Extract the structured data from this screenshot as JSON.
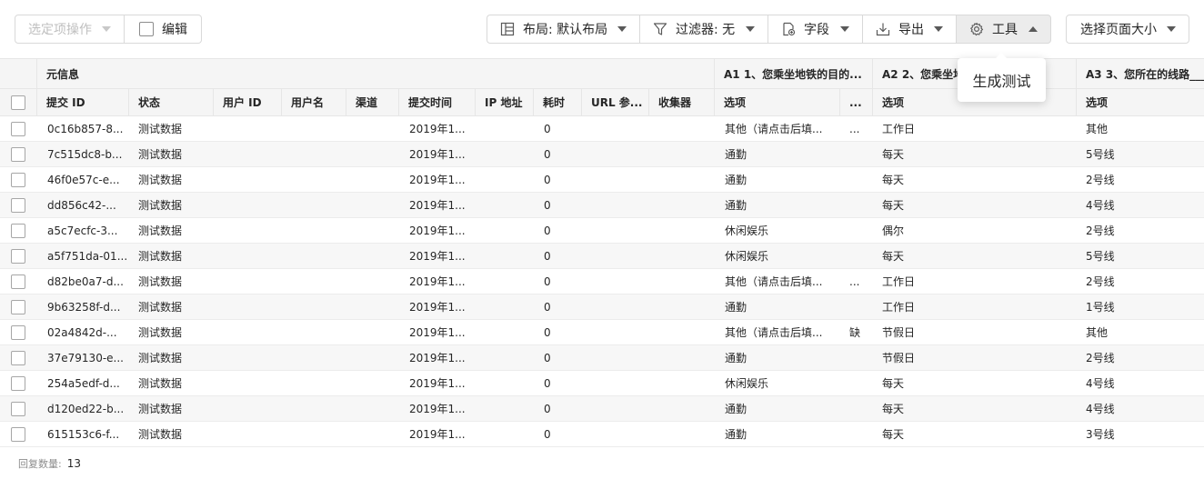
{
  "toolbar": {
    "selection_actions": "选定项操作",
    "edit": "编辑",
    "layout": "布局: 默认布局",
    "filter": "过滤器: 无",
    "fields": "字段",
    "export": "导出",
    "tools": "工具",
    "page_size": "选择页面大小"
  },
  "tooltip": {
    "text": "生成测试"
  },
  "table": {
    "groups": {
      "meta": "元信息",
      "a1": "A1 1、您乘坐地铁的目的...",
      "a2": "A2 2、您乘坐地",
      "a3": "A3 3、您所在的线路___"
    },
    "columns": [
      "提交 ID",
      "状态",
      "用户 ID",
      "用户名",
      "渠道",
      "提交时间",
      "IP 地址",
      "耗时",
      "URL 参...",
      "收集器",
      "选项",
      "...",
      "选项",
      "选项"
    ],
    "rows": [
      {
        "id": "0c16b857-8...",
        "status": "测试数据",
        "time": "2019年1...",
        "duration": "0",
        "a1": "其他（请点击后填...",
        "a1b": "...",
        "a2": "工作日",
        "a3": "其他"
      },
      {
        "id": "7c515dc8-b...",
        "status": "测试数据",
        "time": "2019年1...",
        "duration": "0",
        "a1": "通勤",
        "a1b": "",
        "a2": "每天",
        "a3": "5号线"
      },
      {
        "id": "46f0e57c-e...",
        "status": "测试数据",
        "time": "2019年1...",
        "duration": "0",
        "a1": "通勤",
        "a1b": "",
        "a2": "每天",
        "a3": "2号线"
      },
      {
        "id": "dd856c42-...",
        "status": "测试数据",
        "time": "2019年1...",
        "duration": "0",
        "a1": "通勤",
        "a1b": "",
        "a2": "每天",
        "a3": "4号线"
      },
      {
        "id": "a5c7ecfc-3...",
        "status": "测试数据",
        "time": "2019年1...",
        "duration": "0",
        "a1": "休闲娱乐",
        "a1b": "",
        "a2": "偶尔",
        "a3": "2号线"
      },
      {
        "id": "a5f751da-01...",
        "status": "测试数据",
        "time": "2019年1...",
        "duration": "0",
        "a1": "休闲娱乐",
        "a1b": "",
        "a2": "每天",
        "a3": "5号线"
      },
      {
        "id": "d82be0a7-d...",
        "status": "测试数据",
        "time": "2019年1...",
        "duration": "0",
        "a1": "其他（请点击后填...",
        "a1b": "...",
        "a2": "工作日",
        "a3": "2号线"
      },
      {
        "id": "9b63258f-d...",
        "status": "测试数据",
        "time": "2019年1...",
        "duration": "0",
        "a1": "通勤",
        "a1b": "",
        "a2": "工作日",
        "a3": "1号线"
      },
      {
        "id": "02a4842d-...",
        "status": "测试数据",
        "time": "2019年1...",
        "duration": "0",
        "a1": "其他（请点击后填...",
        "a1b": "缺",
        "a2": "节假日",
        "a3": "其他"
      },
      {
        "id": "37e79130-e...",
        "status": "测试数据",
        "time": "2019年1...",
        "duration": "0",
        "a1": "通勤",
        "a1b": "",
        "a2": "节假日",
        "a3": "2号线"
      },
      {
        "id": "254a5edf-d...",
        "status": "测试数据",
        "time": "2019年1...",
        "duration": "0",
        "a1": "休闲娱乐",
        "a1b": "",
        "a2": "每天",
        "a3": "4号线"
      },
      {
        "id": "d120ed22-b...",
        "status": "测试数据",
        "time": "2019年1...",
        "duration": "0",
        "a1": "通勤",
        "a1b": "",
        "a2": "每天",
        "a3": "4号线"
      },
      {
        "id": "615153c6-f...",
        "status": "测试数据",
        "time": "2019年1...",
        "duration": "0",
        "a1": "通勤",
        "a1b": "",
        "a2": "每天",
        "a3": "3号线"
      }
    ]
  },
  "footer": {
    "label": "回复数量:",
    "count": "13"
  },
  "icons": {
    "layout": "layout-icon",
    "filter": "filter-icon",
    "fields": "add-field-icon",
    "export": "export-icon",
    "tools": "gear-icon"
  }
}
